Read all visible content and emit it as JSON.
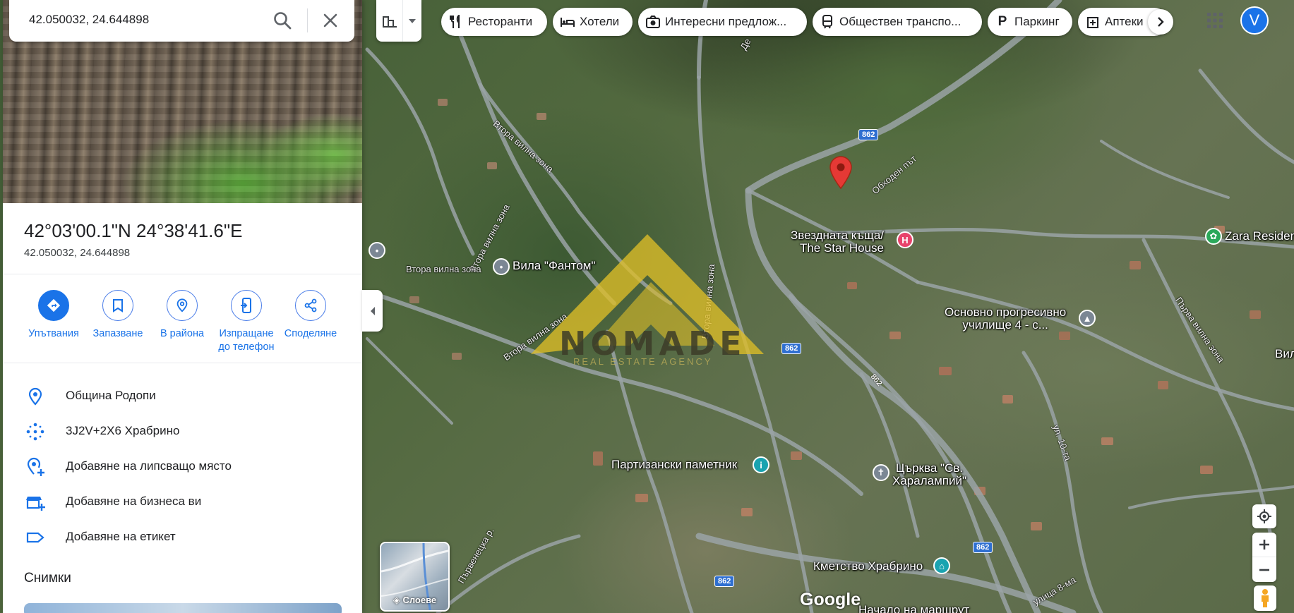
{
  "search": {
    "value": "42.050032, 24.644898"
  },
  "place": {
    "title": "42°03'00.1\"N 24°38'41.6\"E",
    "subtitle": "42.050032, 24.644898"
  },
  "actions": [
    {
      "label": "Упътвания",
      "icon": "directions-icon"
    },
    {
      "label": "Запазване",
      "icon": "bookmark-icon"
    },
    {
      "label": "В района",
      "icon": "nearby-icon"
    },
    {
      "label": "Изпращане\nдо телефон",
      "icon": "send-to-phone-icon"
    },
    {
      "label": "Споделяне",
      "icon": "share-icon"
    }
  ],
  "info": [
    {
      "text": "Община Родопи",
      "icon": "location-pin-icon"
    },
    {
      "text": "3J2V+2X6 Храбрино",
      "icon": "plus-code-icon"
    },
    {
      "text": "Добавяне на липсващо място",
      "icon": "add-place-icon"
    },
    {
      "text": "Добавяне на бизнеса ви",
      "icon": "add-business-icon"
    },
    {
      "text": "Добавяне на етикет",
      "icon": "label-icon"
    }
  ],
  "photos": {
    "title": "Снимки"
  },
  "chips": [
    {
      "label": "Ресторанти",
      "icon": "restaurant-icon"
    },
    {
      "label": "Хотели",
      "icon": "hotel-icon"
    },
    {
      "label": "Интересни предлож...",
      "icon": "camera-icon"
    },
    {
      "label": "Обществен транспо...",
      "icon": "transit-icon"
    },
    {
      "label": "Паркинг",
      "icon": "parking-icon"
    },
    {
      "label": "Аптеки",
      "icon": "pharmacy-icon"
    }
  ],
  "account": {
    "initial": "V"
  },
  "layers": {
    "label": "Слоеве"
  },
  "map": {
    "labels": {
      "star_house": "Звездната къща/\nThe Star House",
      "school": "Основно прогресивно\nучилище 4 - с...",
      "zara": "Zara Residen",
      "vila_fantom": "Вила \"Фантом\"",
      "partisan": "Партизански паметник",
      "church": "Църква \"Св.\nХаралампий\"",
      "mayor": "Кметство Храбрино",
      "start_route": "Начало на маршрут",
      "vil_edge": "Вил"
    },
    "roads": {
      "vtora_1": "Втора вилна зона",
      "vtora_2": "Втора вилна зона",
      "vtora_3": "Втора вилна зона",
      "vtora_4": "Втора вилна зона",
      "vtora_5": "Втора вилна зона",
      "obhoden": "Обходен път",
      "parva": "Първа вилна зона",
      "ul10": "ул. 10-та",
      "ul8": "улица 8-ма",
      "parvenetska": "Първенецка р.",
      "de": "Де"
    },
    "road_numbers": [
      "862",
      "862",
      "862",
      "862",
      "862"
    ],
    "watermark": {
      "name": "NOMADE",
      "sub": "REAL ESTATE AGENCY"
    },
    "logo": "Google"
  }
}
